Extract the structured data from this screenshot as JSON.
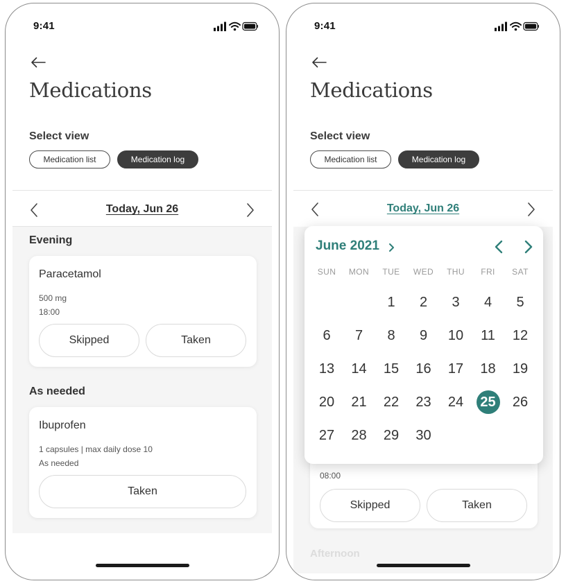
{
  "status_bar": {
    "time": "9:41"
  },
  "header": {
    "title": "Medications"
  },
  "view_selector": {
    "label": "Select view",
    "options": [
      "Medication list",
      "Medication log"
    ],
    "selected": "Medication log"
  },
  "date_nav": {
    "label": "Today, Jun 26"
  },
  "log": {
    "sections": [
      {
        "heading": "Evening",
        "card": {
          "name": "Paracetamol",
          "dose": "500 mg",
          "time": "18:00",
          "buttons": [
            "Skipped",
            "Taken"
          ]
        }
      },
      {
        "heading": "As needed",
        "card": {
          "name": "Ibuprofen",
          "dose": "1 capsules | max daily dose 10",
          "time": "As needed",
          "buttons": [
            "Taken"
          ]
        }
      }
    ]
  },
  "calendar": {
    "month_label": "June 2021",
    "weekdays": [
      "SUN",
      "MON",
      "TUE",
      "WED",
      "THU",
      "FRI",
      "SAT"
    ],
    "first_weekday_index": 2,
    "days_in_month": 30,
    "selected_day": 25
  },
  "background_card": {
    "time": "08:00",
    "buttons": [
      "Skipped",
      "Taken"
    ]
  },
  "faded_heading": "Afternoon",
  "colors": {
    "accent": "#2f7f79",
    "dark_pill": "#3d3d3d",
    "list_background": "#f5f5f5"
  }
}
